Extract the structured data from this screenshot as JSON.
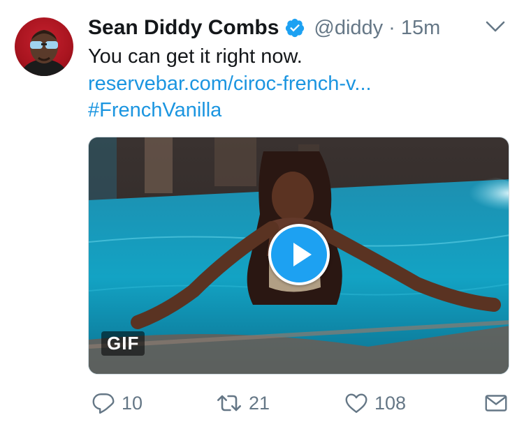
{
  "tweet": {
    "author_name": "Sean Diddy Combs",
    "handle": "@diddy",
    "separator": "·",
    "timestamp": "15m",
    "text": "You can get it right now.",
    "link_text": "reservebar.com/ciroc-french-v...",
    "hashtag": "#FrenchVanilla",
    "media": {
      "badge": "GIF",
      "type": "animated-gif"
    },
    "actions": {
      "replies": "10",
      "retweets": "21",
      "likes": "108"
    }
  },
  "icons": {
    "verified": "verified-badge-icon",
    "caret": "chevron-down-icon",
    "reply": "reply-icon",
    "retweet": "retweet-icon",
    "like": "heart-icon",
    "dm": "envelope-icon",
    "play": "play-icon"
  },
  "colors": {
    "link": "#1b95e0",
    "verified": "#1da1f2",
    "secondary_text": "#657786",
    "primary_text": "#14171a"
  }
}
